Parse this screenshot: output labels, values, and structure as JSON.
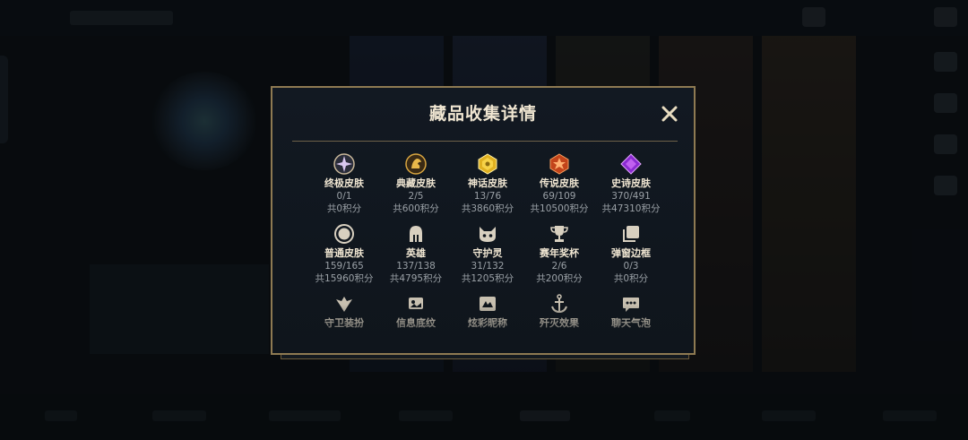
{
  "dialog": {
    "title": "藏品收集详情",
    "close_icon": "close-icon"
  },
  "colors": {
    "border_gold": "#8e7a52",
    "title_text": "#f0e6d2",
    "secondary_text": "#9aa0a6",
    "panel_bg": "#121922"
  },
  "rows": [
    [
      {
        "icon": "ultimate-skin-icon",
        "label": "终极皮肤",
        "count": "0/1",
        "points": "共0积分"
      },
      {
        "icon": "prestige-skin-icon",
        "label": "典藏皮肤",
        "count": "2/5",
        "points": "共600积分"
      },
      {
        "icon": "mythic-skin-icon",
        "label": "神话皮肤",
        "count": "13/76",
        "points": "共3860积分"
      },
      {
        "icon": "legendary-skin-icon",
        "label": "传说皮肤",
        "count": "69/109",
        "points": "共10500积分"
      },
      {
        "icon": "epic-skin-icon",
        "label": "史诗皮肤",
        "count": "370/491",
        "points": "共47310积分"
      }
    ],
    [
      {
        "icon": "normal-skin-icon",
        "label": "普通皮肤",
        "count": "159/165",
        "points": "共15960积分"
      },
      {
        "icon": "champion-helmet-icon",
        "label": "英雄",
        "count": "137/138",
        "points": "共4795积分"
      },
      {
        "icon": "ward-creature-icon",
        "label": "守护灵",
        "count": "31/132",
        "points": "共1205积分"
      },
      {
        "icon": "season-trophy-icon",
        "label": "赛年奖杯",
        "count": "2/6",
        "points": "共200积分"
      },
      {
        "icon": "popup-frame-icon",
        "label": "弹窗边框",
        "count": "0/3",
        "points": "共0积分"
      }
    ],
    [
      {
        "icon": "ward-skin-icon",
        "label": "守卫装扮"
      },
      {
        "icon": "banner-icon",
        "label": "信息底纹"
      },
      {
        "icon": "title-frame-icon",
        "label": "炫彩昵称"
      },
      {
        "icon": "finisher-anchor-icon",
        "label": "歼灭效果"
      },
      {
        "icon": "chat-bubble-icon",
        "label": "聊天气泡"
      }
    ]
  ]
}
